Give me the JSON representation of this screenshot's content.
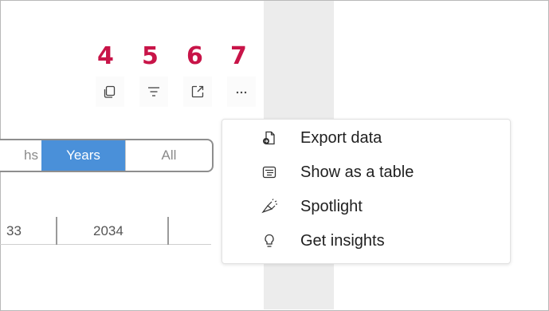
{
  "callouts": [
    "4",
    "5",
    "6",
    "7"
  ],
  "toolbar": {
    "icons": [
      "copy-icon",
      "filter-icon",
      "focus-mode-icon",
      "more-options-icon"
    ]
  },
  "period_selector": {
    "options": [
      "hs",
      "Years",
      "All"
    ],
    "selected": "Years"
  },
  "axis": {
    "labels": [
      "33",
      "2034"
    ]
  },
  "menu": {
    "items": [
      {
        "label": "Export data",
        "icon": "export-data-icon"
      },
      {
        "label": "Show as a table",
        "icon": "table-icon"
      },
      {
        "label": "Spotlight",
        "icon": "spotlight-icon"
      },
      {
        "label": "Get insights",
        "icon": "lightbulb-icon"
      }
    ]
  },
  "colors": {
    "callout": "#c81448",
    "selected_segment": "#4a90d9",
    "side_strip": "#ececec"
  }
}
